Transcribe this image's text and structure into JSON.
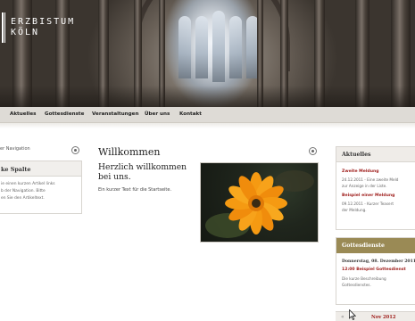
{
  "site": {
    "logo_line1": "ERZBISTUM",
    "logo_line2": "KÖLN"
  },
  "nav": {
    "items": [
      {
        "label": "Aktuelles"
      },
      {
        "label": "Gottesdienste"
      },
      {
        "label": "Veranstaltungen"
      },
      {
        "label": "Über uns"
      },
      {
        "label": "Kontakt"
      }
    ]
  },
  "left": {
    "top_label": "er Navigation",
    "box_title": "ke Spalte",
    "box_lines": [
      "ie einen kurzen Artikel links",
      "b der Navigation. Bitte",
      "en Sie den Artikeltext."
    ]
  },
  "main": {
    "title": "Willkommen",
    "subtitle": "Herzlich willkommen bei uns.",
    "text": "Ein kurzer Text für die Startseite."
  },
  "right": {
    "news": {
      "title": "Aktuelles",
      "items": [
        {
          "link": "Zweite Meldung",
          "lines": [
            "24.12.2011 - Eine zweite Meld",
            "zur Anzeige in der Liste."
          ]
        },
        {
          "link": "Beispiel einer Meldung",
          "lines": [
            "09.12.2011 - Kurzer Teasert",
            "der Meldung."
          ]
        }
      ]
    },
    "services": {
      "title": "Gottesdienste",
      "date": "Donnerstag, 08. Dezember 2011",
      "link": "12:00 Beispiel Gottesdienst",
      "lines": [
        "Die kurze Beschreibung",
        "Gottesdienstes."
      ]
    },
    "calendar": {
      "prev": "«",
      "month": "Nov 2012"
    }
  },
  "colors": {
    "accent_red": "#a0211f",
    "gold_header": "#9a8a55",
    "nav_bg": "#dedbd6"
  }
}
